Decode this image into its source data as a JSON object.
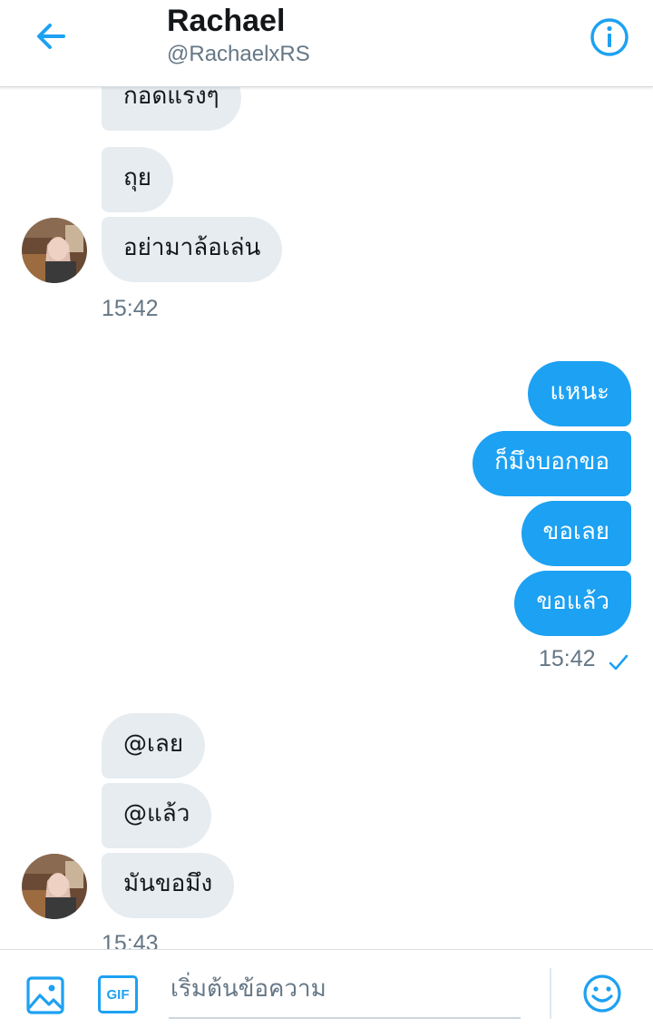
{
  "header": {
    "title": "Rachael",
    "handle": "@RachaelxRS"
  },
  "colors": {
    "accent": "#1da1f2",
    "received_bubble": "#e6ecf0",
    "secondary_text": "#657786"
  },
  "messages": {
    "group1": {
      "items": [
        "กอดแรงๆ",
        "ถุย",
        "อย่ามาล้อเล่น"
      ],
      "time": "15:42"
    },
    "group2": {
      "items": [
        "แหนะ",
        "ก็มึงบอกขอ",
        "ขอเลย",
        "ขอแล้ว"
      ],
      "time": "15:42",
      "status_icon": "check-icon"
    },
    "group3": {
      "items": [
        "@เลย",
        "@แล้ว",
        "มันขอมึง"
      ],
      "time": "15:43"
    }
  },
  "composer": {
    "placeholder": "เริ่มต้นข้อความ",
    "gif_label": "GIF"
  }
}
